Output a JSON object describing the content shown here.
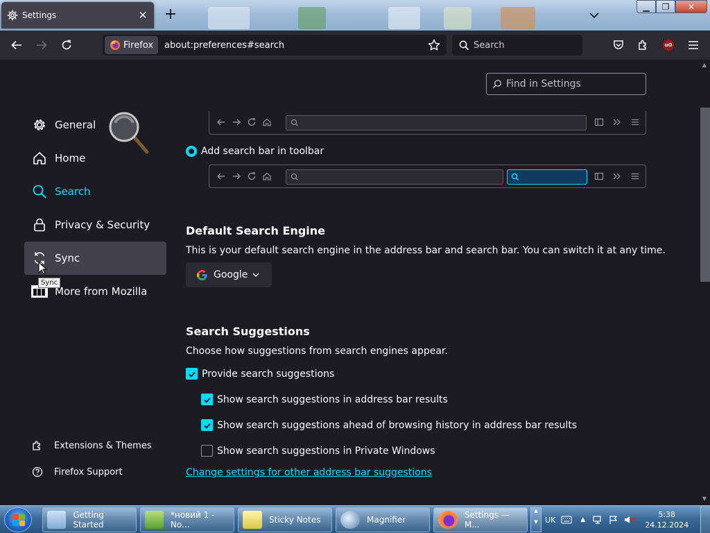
{
  "browser": {
    "tab_title": "Settings",
    "identity_label": "Firefox",
    "url": "about:preferences#search",
    "search_placeholder": "Search"
  },
  "find_in_settings": {
    "placeholder": "Find in Settings"
  },
  "sidebar": {
    "items": [
      {
        "label": "General",
        "icon": "gear-icon"
      },
      {
        "label": "Home",
        "icon": "home-icon"
      },
      {
        "label": "Search",
        "icon": "search-icon",
        "selected": true
      },
      {
        "label": "Privacy & Security",
        "icon": "lock-icon"
      },
      {
        "label": "Sync",
        "icon": "sync-icon",
        "hovered": true
      },
      {
        "label": "More from Mozilla",
        "icon": "mozilla-icon"
      }
    ],
    "tooltip": "Sync",
    "footer": [
      {
        "label": "Extensions & Themes",
        "icon": "puzzle-icon"
      },
      {
        "label": "Firefox Support",
        "icon": "help-icon"
      }
    ]
  },
  "search_bar": {
    "add_option_label": "Add search bar in toolbar"
  },
  "default_engine": {
    "heading": "Default Search Engine",
    "description": "This is your default search engine in the address bar and search bar. You can switch it at any time.",
    "selected": "Google"
  },
  "suggestions": {
    "heading": "Search Suggestions",
    "description": "Choose how suggestions from search engines appear.",
    "options": [
      {
        "label": "Provide search suggestions",
        "checked": true
      },
      {
        "label": "Show search suggestions in address bar results",
        "checked": true
      },
      {
        "label": "Show search suggestions ahead of browsing history in address bar results",
        "checked": true
      },
      {
        "label": "Show search suggestions in Private Windows",
        "checked": false
      }
    ],
    "link": "Change settings for other address bar suggestions"
  },
  "taskbar": {
    "tasks": [
      {
        "label": "Getting Started"
      },
      {
        "label": "*новий 1 - No..."
      },
      {
        "label": "Sticky Notes"
      },
      {
        "label": "Magnifier"
      },
      {
        "label": "Settings — M..."
      }
    ],
    "language": "UK",
    "time": "5:38",
    "date": "24.12.2024"
  },
  "colors": {
    "accent": "#00ddff",
    "page_bg": "#1c1b22",
    "toolbar_bg": "#2b2a33"
  }
}
